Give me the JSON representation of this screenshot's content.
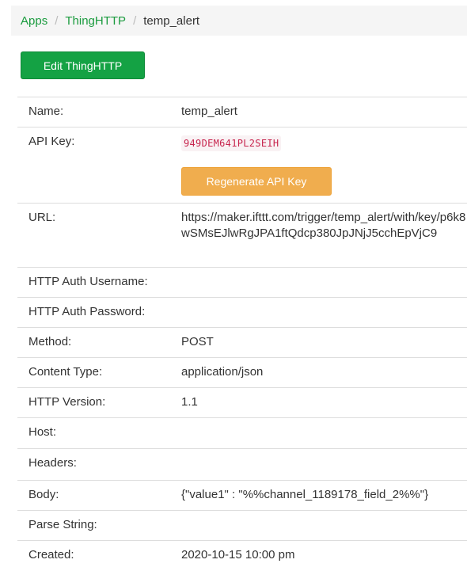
{
  "breadcrumb": {
    "items": [
      "Apps",
      "ThingHTTP"
    ],
    "separator": "/",
    "current": "temp_alert"
  },
  "actions": {
    "edit_label": "Edit ThingHTTP",
    "regenerate_label": "Regenerate API Key"
  },
  "colors": {
    "link": "#1a9b3e",
    "edit_button": "#14a244",
    "regenerate_button": "#f0ad4e",
    "api_key_text": "#c7254e"
  },
  "fields": {
    "name": {
      "label": "Name:",
      "value": "temp_alert"
    },
    "api_key": {
      "label": "API Key:",
      "value": "949DEM641PL2SEIH"
    },
    "url": {
      "label": "URL:",
      "value": "https://maker.ifttt.com/trigger/temp_alert/with/key/p6k8wSMsEJlwRgJPA1ftQdcp380JpJNjJ5cchEpVjC9"
    },
    "http_auth_username": {
      "label": "HTTP Auth Username:",
      "value": ""
    },
    "http_auth_password": {
      "label": "HTTP Auth Password:",
      "value": ""
    },
    "method": {
      "label": "Method:",
      "value": "POST"
    },
    "content_type": {
      "label": "Content Type:",
      "value": "application/json"
    },
    "http_version": {
      "label": "HTTP Version:",
      "value": "1.1"
    },
    "host": {
      "label": "Host:",
      "value": ""
    },
    "headers": {
      "label": "Headers:",
      "value": ""
    },
    "body": {
      "label": "Body:",
      "value": "{\"value1\" : \"%%channel_1189178_field_2%%\"}"
    },
    "parse_string": {
      "label": "Parse String:",
      "value": ""
    },
    "created": {
      "label": "Created:",
      "value": "2020-10-15 10:00 pm"
    }
  }
}
